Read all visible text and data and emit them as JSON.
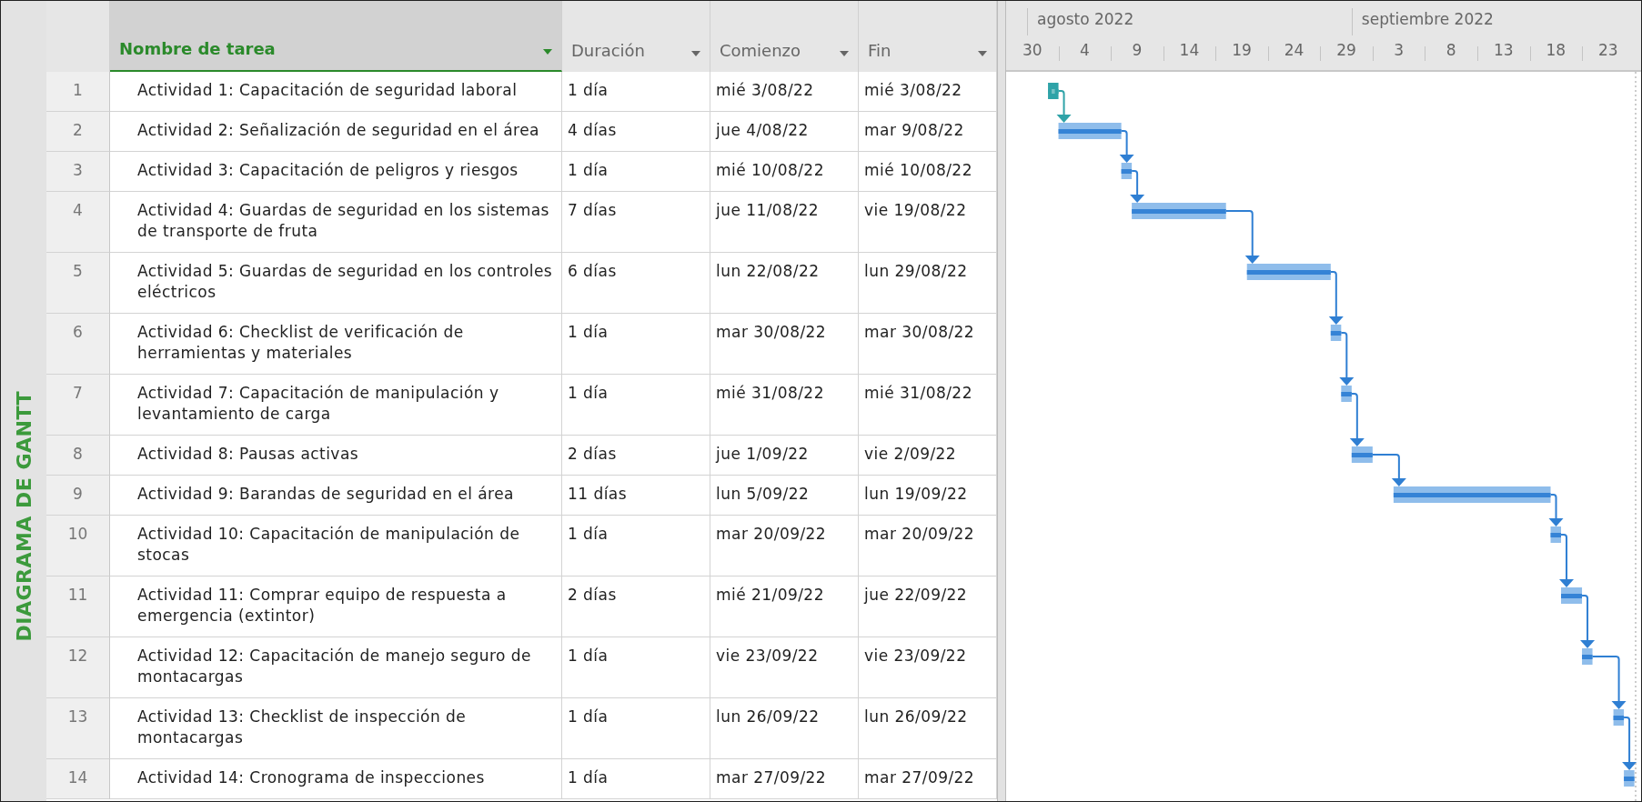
{
  "side_label": "DIAGRAMA DE GANTT",
  "columns": [
    {
      "label": "Nombre de tarea",
      "selected": true
    },
    {
      "label": "Duración",
      "selected": false
    },
    {
      "label": "Comienzo",
      "selected": false
    },
    {
      "label": "Fin",
      "selected": false
    }
  ],
  "timescale": {
    "months": [
      "agosto 2022",
      "septiembre 2022"
    ],
    "days": [
      "30",
      "4",
      "9",
      "14",
      "19",
      "24",
      "29",
      "3",
      "8",
      "13",
      "18",
      "23"
    ]
  },
  "tasks": [
    {
      "id": "1",
      "name": "Actividad 1: Capacitación de seguridad laboral",
      "duration": "1 día",
      "start": "mié 3/08/22",
      "finish": "mié 3/08/22",
      "kind": "manual"
    },
    {
      "id": "2",
      "name": "Actividad 2: Señalización de seguridad en el área",
      "duration": "4 días",
      "start": "jue 4/08/22",
      "finish": "mar 9/08/22",
      "kind": "auto"
    },
    {
      "id": "3",
      "name": "Actividad 3: Capacitación de peligros y riesgos",
      "duration": "1 día",
      "start": "mié 10/08/22",
      "finish": "mié 10/08/22",
      "kind": "auto"
    },
    {
      "id": "4",
      "name": "Actividad 4: Guardas de seguridad en los sistemas de transporte de fruta",
      "duration": "7 días",
      "start": "jue 11/08/22",
      "finish": "vie 19/08/22",
      "kind": "auto"
    },
    {
      "id": "5",
      "name": "Actividad 5: Guardas de seguridad en los controles eléctricos",
      "duration": "6 días",
      "start": "lun 22/08/22",
      "finish": "lun 29/08/22",
      "kind": "auto"
    },
    {
      "id": "6",
      "name": "Actividad 6: Checklist de verificación de herramientas y materiales",
      "duration": "1 día",
      "start": "mar 30/08/22",
      "finish": "mar 30/08/22",
      "kind": "auto"
    },
    {
      "id": "7",
      "name": "Actividad 7: Capacitación de manipulación y levantamiento de carga",
      "duration": "1 día",
      "start": "mié 31/08/22",
      "finish": "mié 31/08/22",
      "kind": "auto"
    },
    {
      "id": "8",
      "name": "Actividad 8: Pausas activas",
      "duration": "2 días",
      "start": "jue 1/09/22",
      "finish": "vie 2/09/22",
      "kind": "auto"
    },
    {
      "id": "9",
      "name": "Actividad 9: Barandas de seguridad en el área",
      "duration": "11 días",
      "start": "lun 5/09/22",
      "finish": "lun 19/09/22",
      "kind": "auto"
    },
    {
      "id": "10",
      "name": "Actividad 10: Capacitación de manipulación de stocas",
      "duration": "1 día",
      "start": "mar 20/09/22",
      "finish": "mar 20/09/22",
      "kind": "auto"
    },
    {
      "id": "11",
      "name": "Actividad 11: Comprar equipo de respuesta a emergencia (extintor)",
      "duration": "2 días",
      "start": "mié 21/09/22",
      "finish": "jue 22/09/22",
      "kind": "auto"
    },
    {
      "id": "12",
      "name": "Actividad 12: Capacitación de manejo seguro de montacargas",
      "duration": "1 día",
      "start": "vie 23/09/22",
      "finish": "vie 23/09/22",
      "kind": "auto"
    },
    {
      "id": "13",
      "name": "Actividad 13: Checklist de inspección de montacargas",
      "duration": "1 día",
      "start": "lun 26/09/22",
      "finish": "lun 26/09/22",
      "kind": "auto"
    },
    {
      "id": "14",
      "name": "Actividad 14: Cronograma de inspecciones",
      "duration": "1 día",
      "start": "mar 27/09/22",
      "finish": "mar 27/09/22",
      "kind": "auto"
    }
  ]
}
